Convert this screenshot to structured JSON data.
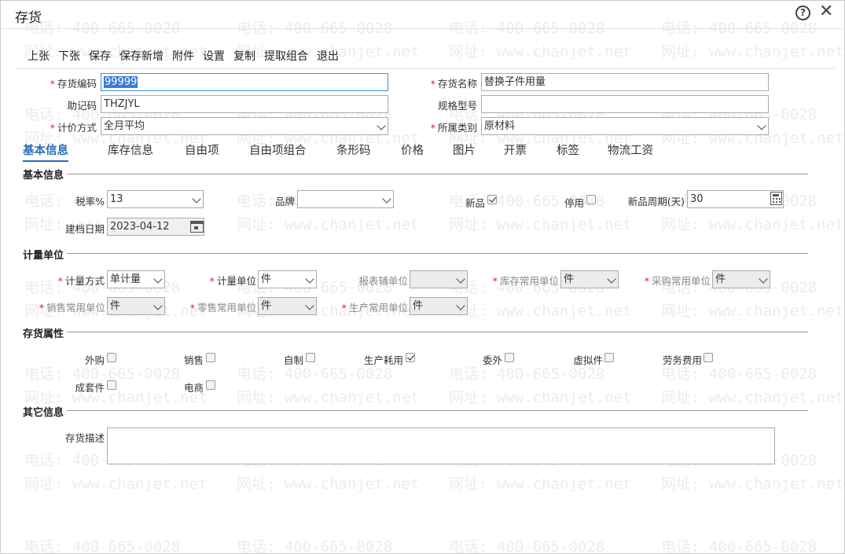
{
  "window": {
    "title": "存货"
  },
  "watermark": {
    "phone": "电话: 400-665-0028",
    "site": "网址: www.chanjet.net"
  },
  "toolbar": {
    "items": [
      "上张",
      "下张",
      "保存",
      "保存新增",
      "附件",
      "设置",
      "复制",
      "提取组合",
      "退出"
    ]
  },
  "header": {
    "code_label": "存货编码",
    "code_value": "99999",
    "name_label": "存货名称",
    "name_value": "替换子件用量",
    "mnemonic_label": "助记码",
    "mnemonic_value": "THZJYL",
    "spec_label": "规格型号",
    "spec_value": "",
    "pricing_label": "计价方式",
    "pricing_value": "全月平均",
    "category_label": "所属类别",
    "category_value": "原材料"
  },
  "tabs": [
    "基本信息",
    "库存信息",
    "自由项",
    "自由项组合",
    "条形码",
    "价格",
    "图片",
    "开票",
    "标签",
    "物流工资"
  ],
  "basic": {
    "section_title": "基本信息",
    "tax_label": "税率%",
    "tax_value": "13",
    "brand_label": "品牌",
    "brand_value": "",
    "new_label": "新品",
    "new_checked": true,
    "disabled_label": "停用",
    "disabled_checked": false,
    "cycle_label": "新品周期(天)",
    "cycle_value": "30",
    "created_label": "建档日期",
    "created_value": "2023-04-12"
  },
  "unit": {
    "section_title": "计量单位",
    "method_label": "计量方式",
    "method_value": "单计量",
    "unit_label": "计量单位",
    "unit_value": "件",
    "report_aux_label": "报表辅单位",
    "report_aux_value": "",
    "stock_label": "库存常用单位",
    "stock_value": "件",
    "purchase_label": "采购常用单位",
    "purchase_value": "件",
    "sales_label": "销售常用单位",
    "sales_value": "件",
    "retail_label": "零售常用单位",
    "retail_value": "件",
    "production_label": "生产常用单位",
    "production_value": "件"
  },
  "attrs": {
    "section_title": "存货属性",
    "items": [
      {
        "label": "外购",
        "checked": false
      },
      {
        "label": "销售",
        "checked": false
      },
      {
        "label": "自制",
        "checked": false
      },
      {
        "label": "生产耗用",
        "checked": true
      },
      {
        "label": "委外",
        "checked": false
      },
      {
        "label": "虚拟件",
        "checked": false
      },
      {
        "label": "劳务费用",
        "checked": false
      },
      {
        "label": "成套件",
        "checked": false
      },
      {
        "label": "电商",
        "checked": false
      }
    ]
  },
  "other": {
    "section_title": "其它信息",
    "desc_label": "存货描述",
    "desc_value": ""
  }
}
